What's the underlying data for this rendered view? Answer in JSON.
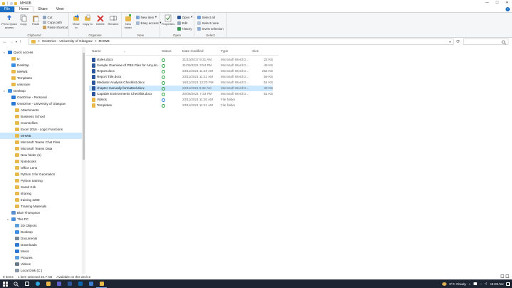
{
  "window": {
    "title": "MHWB",
    "controls": {
      "minimize": "—",
      "maximize": "☐",
      "close": "✕"
    }
  },
  "tabs": [
    {
      "label": "File"
    },
    {
      "label": "Home"
    },
    {
      "label": "Share"
    },
    {
      "label": "View"
    }
  ],
  "ribbon": {
    "clipboard": {
      "label": "Clipboard",
      "pin": "Pin to Quick access",
      "copy": "Copy",
      "paste": "Paste",
      "cut": "Cut",
      "copy_path": "Copy path",
      "paste_shortcut": "Paste shortcut"
    },
    "organise": {
      "label": "Organise",
      "move_to": "Move to",
      "copy_to": "Copy to",
      "delete": "Delete",
      "rename": "Rename"
    },
    "new": {
      "label": "New",
      "new_folder": "New folder",
      "new_item": "New item",
      "easy_access": "Easy access"
    },
    "open": {
      "label": "Open",
      "properties": "Properties",
      "open": "Open",
      "edit": "Edit",
      "history": "History"
    },
    "select": {
      "label": "Select",
      "select_all": "Select all",
      "select_none": "Select none",
      "invert": "Invert selection"
    }
  },
  "address": {
    "crumbs": [
      "OneDrive - University of Glasgow",
      "MHWB"
    ],
    "separator": ">"
  },
  "sidebar": {
    "items": [
      {
        "label": "Quick access",
        "level": 0,
        "color": "#2a7ad5",
        "exp": "v"
      },
      {
        "label": "tv",
        "level": 1,
        "color": "#e8b84a"
      },
      {
        "label": "Desktop",
        "level": 1,
        "color": "#3a8de0"
      },
      {
        "label": "MHWB",
        "level": 1,
        "color": "#e8b84a"
      },
      {
        "label": "Templates",
        "level": 1,
        "color": "#e8b84a"
      },
      {
        "label": "unknown",
        "level": 1,
        "color": "#e8b84a"
      },
      {
        "label": "Desktop",
        "level": 0,
        "color": "#3a8de0",
        "exp": "v"
      },
      {
        "label": "OneDrive - Personal",
        "level": 1,
        "color": "#2a7ad5"
      },
      {
        "label": "OneDrive - University of Glasgow",
        "level": 1,
        "color": "#2a7ad5"
      },
      {
        "label": "Attachments",
        "level": 2,
        "color": "#e8b84a"
      },
      {
        "label": "Business School",
        "level": 2,
        "color": "#e8b84a"
      },
      {
        "label": "Counsellies",
        "level": 2,
        "color": "#e8b84a"
      },
      {
        "label": "Excel 2016 - Logic Functions",
        "level": 2,
        "color": "#e8b84a"
      },
      {
        "label": "MHWB",
        "level": 2,
        "color": "#e8b84a",
        "selected": true
      },
      {
        "label": "Microsoft Teams Chat Files",
        "level": 2,
        "color": "#e8b84a"
      },
      {
        "label": "Microsoft Teams Data",
        "level": 2,
        "color": "#e8b84a"
      },
      {
        "label": "New folder (1)",
        "level": 2,
        "color": "#e8b84a"
      },
      {
        "label": "Notebooks",
        "level": 2,
        "color": "#e8b84a"
      },
      {
        "label": "Office Lens",
        "level": 2,
        "color": "#e8b84a"
      },
      {
        "label": "Python 3 for Geomatics",
        "level": 2,
        "color": "#e8b84a"
      },
      {
        "label": "Python training",
        "level": 2,
        "color": "#e8b84a"
      },
      {
        "label": "Sarah Kirk",
        "level": 2,
        "color": "#e8b84a"
      },
      {
        "label": "sharing",
        "level": 2,
        "color": "#e8b84a"
      },
      {
        "label": "training 2208",
        "level": 2,
        "color": "#e8b84a"
      },
      {
        "label": "Training Materials",
        "level": 2,
        "color": "#e8b84a"
      },
      {
        "label": "Blair Thompson",
        "level": 1,
        "color": "#5b8fd0"
      },
      {
        "label": "This PC",
        "level": 1,
        "color": "#4a90d9",
        "exp": "v"
      },
      {
        "label": "3D Objects",
        "level": 2,
        "color": "#5aa0e0"
      },
      {
        "label": "Desktop",
        "level": 2,
        "color": "#3a8de0"
      },
      {
        "label": "Documents",
        "level": 2,
        "color": "#7a8a9a"
      },
      {
        "label": "Downloads",
        "level": 2,
        "color": "#2a7ad5"
      },
      {
        "label": "Music",
        "level": 2,
        "color": "#2a7ad5"
      },
      {
        "label": "Pictures",
        "level": 2,
        "color": "#5aa0e0"
      },
      {
        "label": "Videos",
        "level": 2,
        "color": "#6a7a8a"
      },
      {
        "label": "Local Disk (C:)",
        "level": 2,
        "color": "#8a9aaa"
      }
    ]
  },
  "columns": {
    "name": "Name",
    "status": "Status",
    "date": "Date modified",
    "type": "Type",
    "size": "Size"
  },
  "files": [
    {
      "name": "styles.docx",
      "date": "31/10/2017 9:31 AM",
      "type": "Microsoft Word D...",
      "size": "22 KB",
      "icon": "word",
      "status": "synced"
    },
    {
      "name": "Sample Overview of PBS Plan for Amy.do...",
      "date": "31/05/2021 3:54 PM",
      "type": "Microsoft Word D...",
      "size": "49 KB",
      "icon": "word",
      "status": "synced"
    },
    {
      "name": "Report.docx",
      "date": "23/11/2021 11:19 AM",
      "type": "Microsoft Word D...",
      "size": "252 KB",
      "icon": "word",
      "status": "synced"
    },
    {
      "name": "Report Title.docx",
      "date": "23/11/2021 11:21 AM",
      "type": "Microsoft Word D...",
      "size": "59 KB",
      "icon": "word",
      "status": "synced"
    },
    {
      "name": "Mediator Analysis Checklist.docx",
      "date": "18/11/2021 12:20 PM",
      "type": "Microsoft Word D...",
      "size": "51 KB",
      "icon": "word",
      "status": "synced"
    },
    {
      "name": "chapter manually formatted.docx",
      "date": "23/11/2021 9:32 AM",
      "type": "Microsoft Word D...",
      "size": "33 KB",
      "icon": "word",
      "status": "synced",
      "selected": true
    },
    {
      "name": "Capable Environments Checklist.docx",
      "date": "20/08/2021 7:33 PM",
      "type": "Microsoft Word D...",
      "size": "51 KB",
      "icon": "word",
      "status": "synced"
    },
    {
      "name": "Videos",
      "date": "23/11/2021 11:20 AM",
      "type": "File folder",
      "size": "",
      "icon": "folder",
      "status": "syncing"
    },
    {
      "name": "Templates",
      "date": "23/11/2021 11:21 AM",
      "type": "File folder",
      "size": "",
      "icon": "folder",
      "status": "synced"
    }
  ],
  "statusbar": {
    "items": "9 items",
    "selected": "1 item selected  34.7 KB",
    "availability": "Available on this device"
  },
  "taskbar": {
    "weather": "9°C  Cloudy",
    "time": "11:23 AM",
    "apps": [
      "start",
      "search",
      "task-view",
      "edge",
      "explorer",
      "teams",
      "word",
      "outlook",
      "store",
      "explorer-active"
    ]
  }
}
